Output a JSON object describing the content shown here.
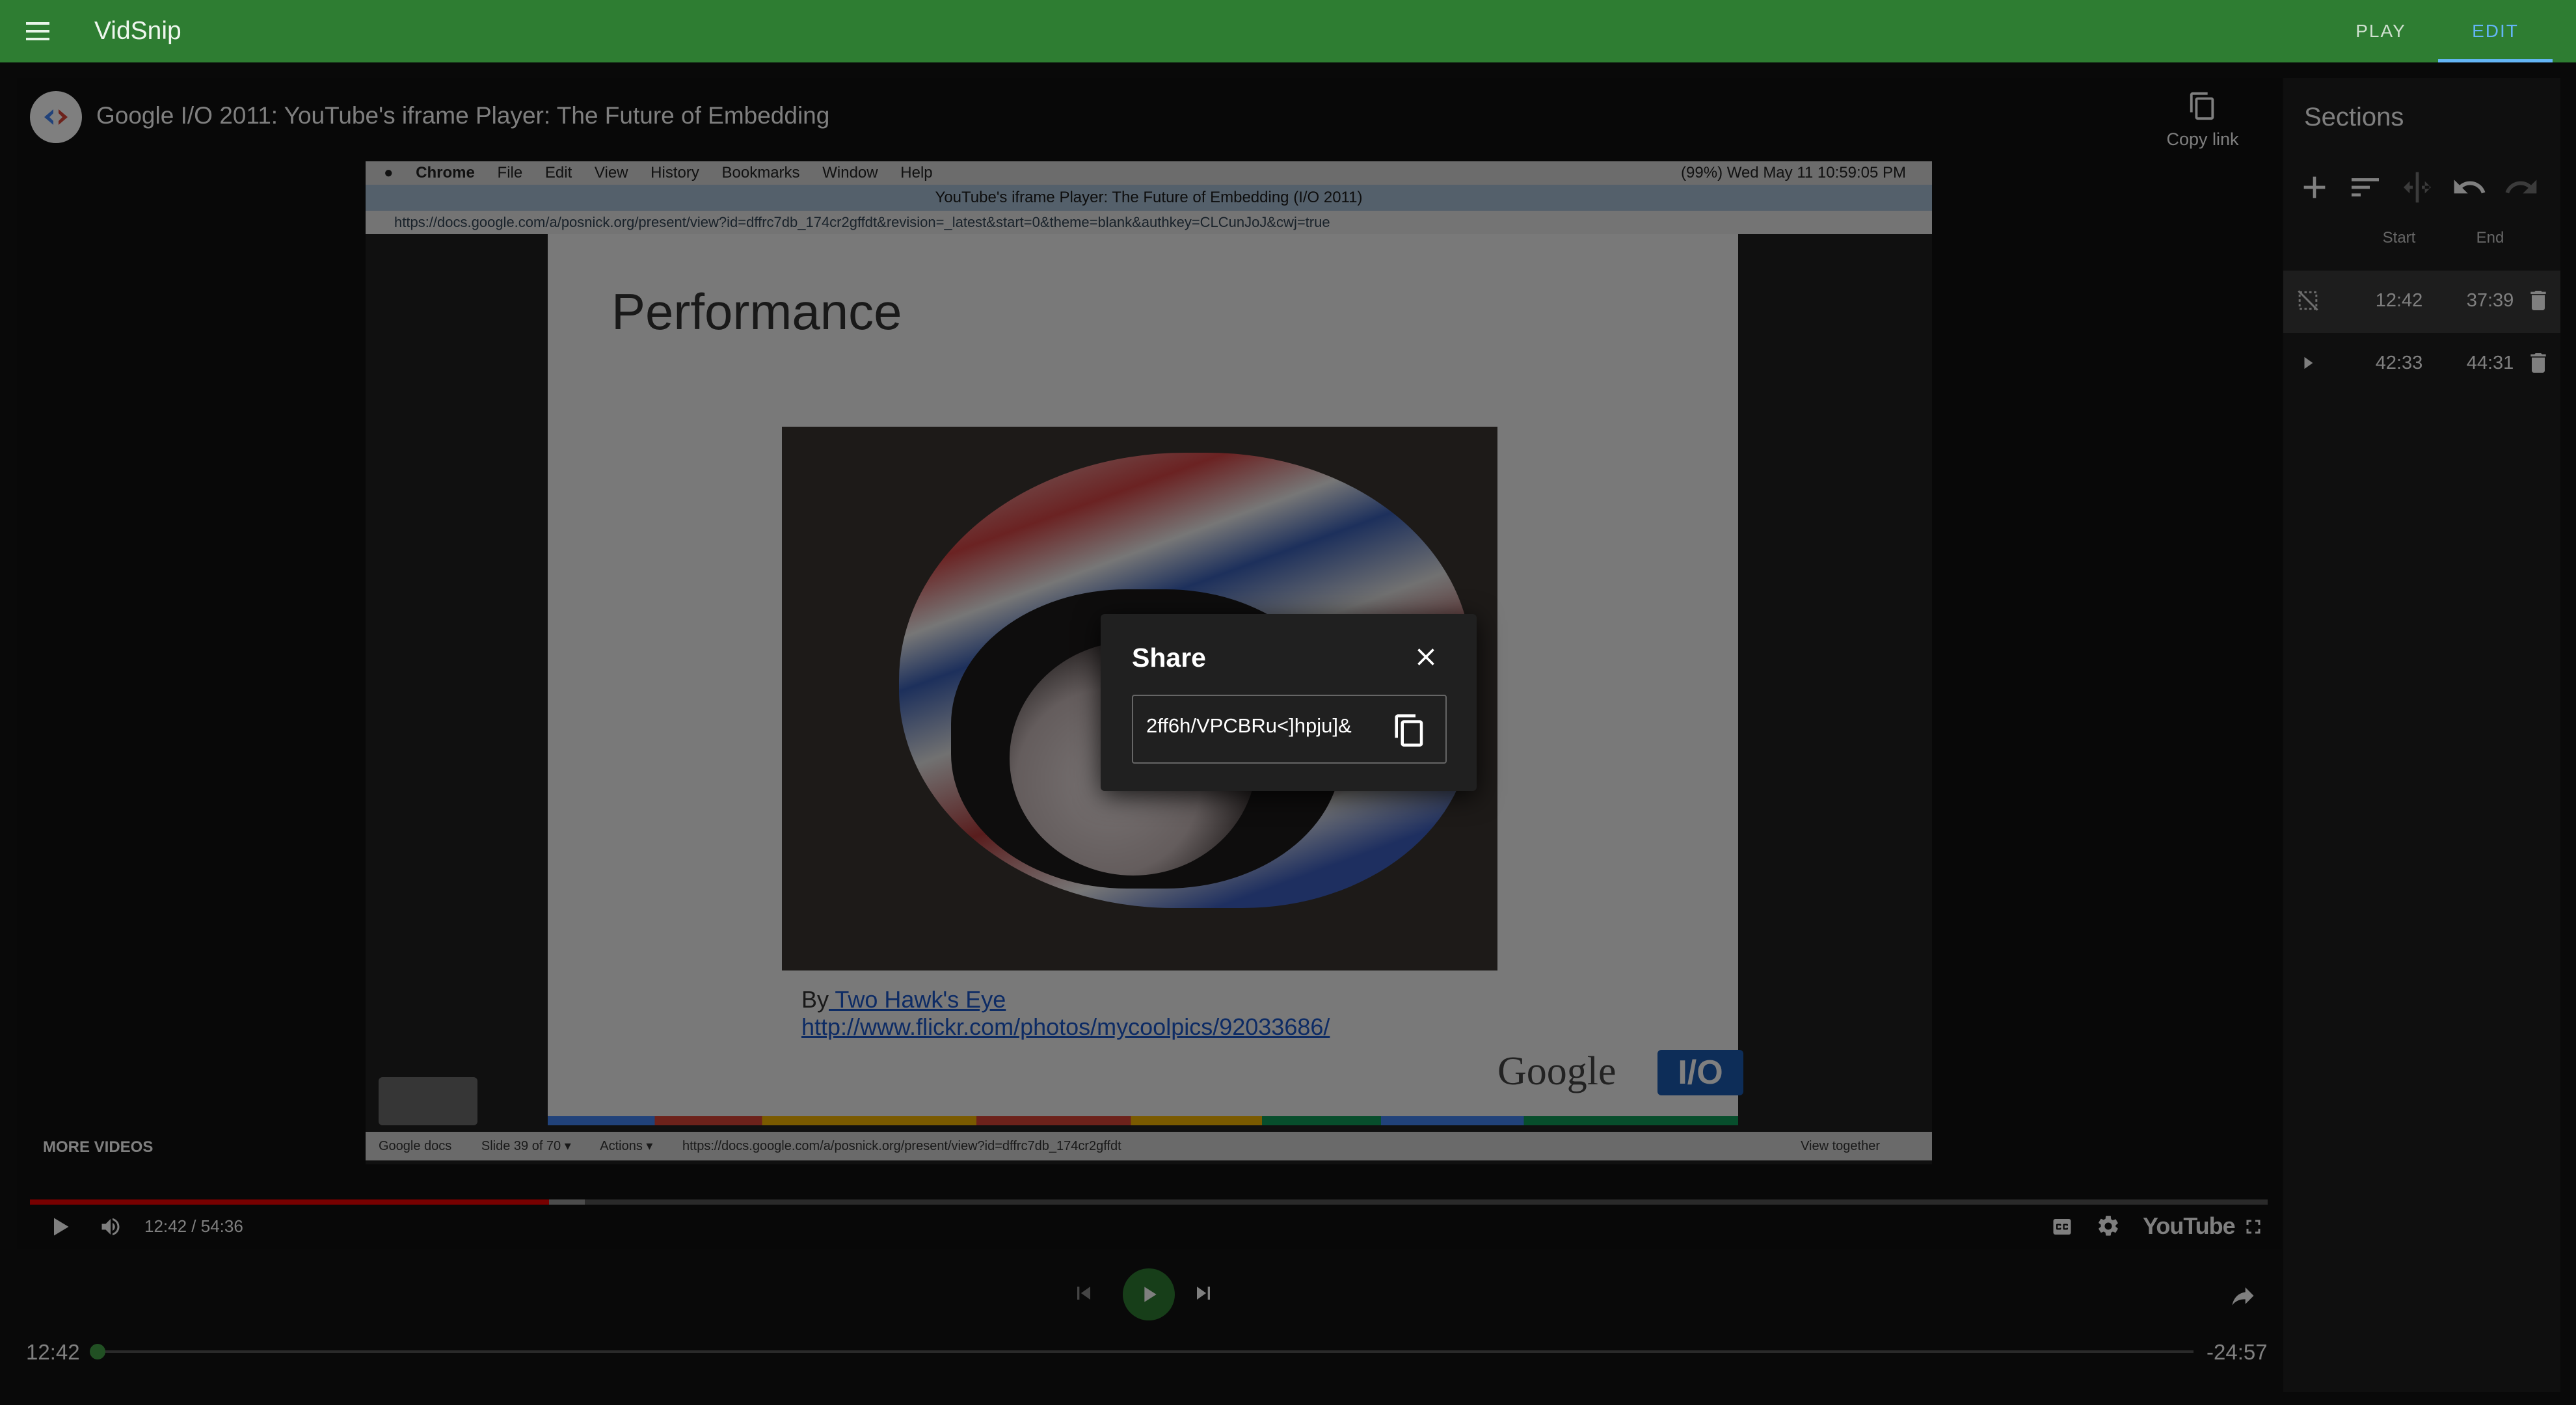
{
  "app": {
    "title": "VidSnip",
    "menu_icon": "menu-icon"
  },
  "nav": {
    "play_label": "PLAY",
    "edit_label": "EDIT",
    "active": "EDIT"
  },
  "colors": {
    "primary": "#2e7d32",
    "accent": "#64b5f6",
    "progress": "#e00000"
  },
  "player": {
    "title": "Google I/O 2011: YouTube's iframe Player: The Future of Embedding",
    "copy_link_label": "Copy link",
    "more_videos_label": "MORE VIDEOS",
    "time_display": "12:42 / 54:36",
    "played_fraction": 0.232,
    "buffered_fraction": 0.248,
    "brand_label": "YouTube"
  },
  "slide": {
    "mac_menu": [
      "Chrome",
      "File",
      "Edit",
      "View",
      "History",
      "Bookmarks",
      "Window",
      "Help"
    ],
    "mac_status": "(99%)  Wed May 11  10:59:05 PM",
    "window_title": "YouTube's iframe Player: The Future of Embedding (I/O 2011)",
    "url": "https://docs.google.com/a/posnick.org/present/view?id=dffrc7db_174cr2gffdt&revision=_latest&start=0&theme=blank&authkey=CLCunJoJ&cwj=true",
    "heading": "Performance",
    "credit_prefix": "By",
    "credit_name": " Two Hawk's Eye",
    "credit_url": "http://www.flickr.com/photos/mycoolpics/92033686/",
    "logo_text": "Google",
    "logo_badge": "I/O",
    "docs_bar": [
      "Google docs",
      "Slide 39 of 70 ▾",
      "Actions ▾",
      "https://docs.google.com/a/posnick.org/present/view?id=dffrc7db_174cr2gffdt",
      "View together"
    ]
  },
  "controls": {
    "current_time": "12:42",
    "remaining_time": "-24:57",
    "scrub_fraction": 0.0
  },
  "sections": {
    "title": "Sections",
    "toolbar": [
      "add-icon",
      "sort-icon",
      "split-icon",
      "undo-icon",
      "redo-icon"
    ],
    "start_header": "Start",
    "end_header": "End",
    "rows": [
      {
        "start": "12:42",
        "end": "37:39",
        "icon": "no-loop-icon",
        "selected": true
      },
      {
        "start": "42:33",
        "end": "44:31",
        "icon": "play-arrow-icon",
        "selected": false
      }
    ]
  },
  "share_dialog": {
    "title": "Share",
    "link_value": "2ff6h/VPCBRu<]hpju]&",
    "close_icon": "close-icon",
    "copy_icon": "copy-icon"
  }
}
